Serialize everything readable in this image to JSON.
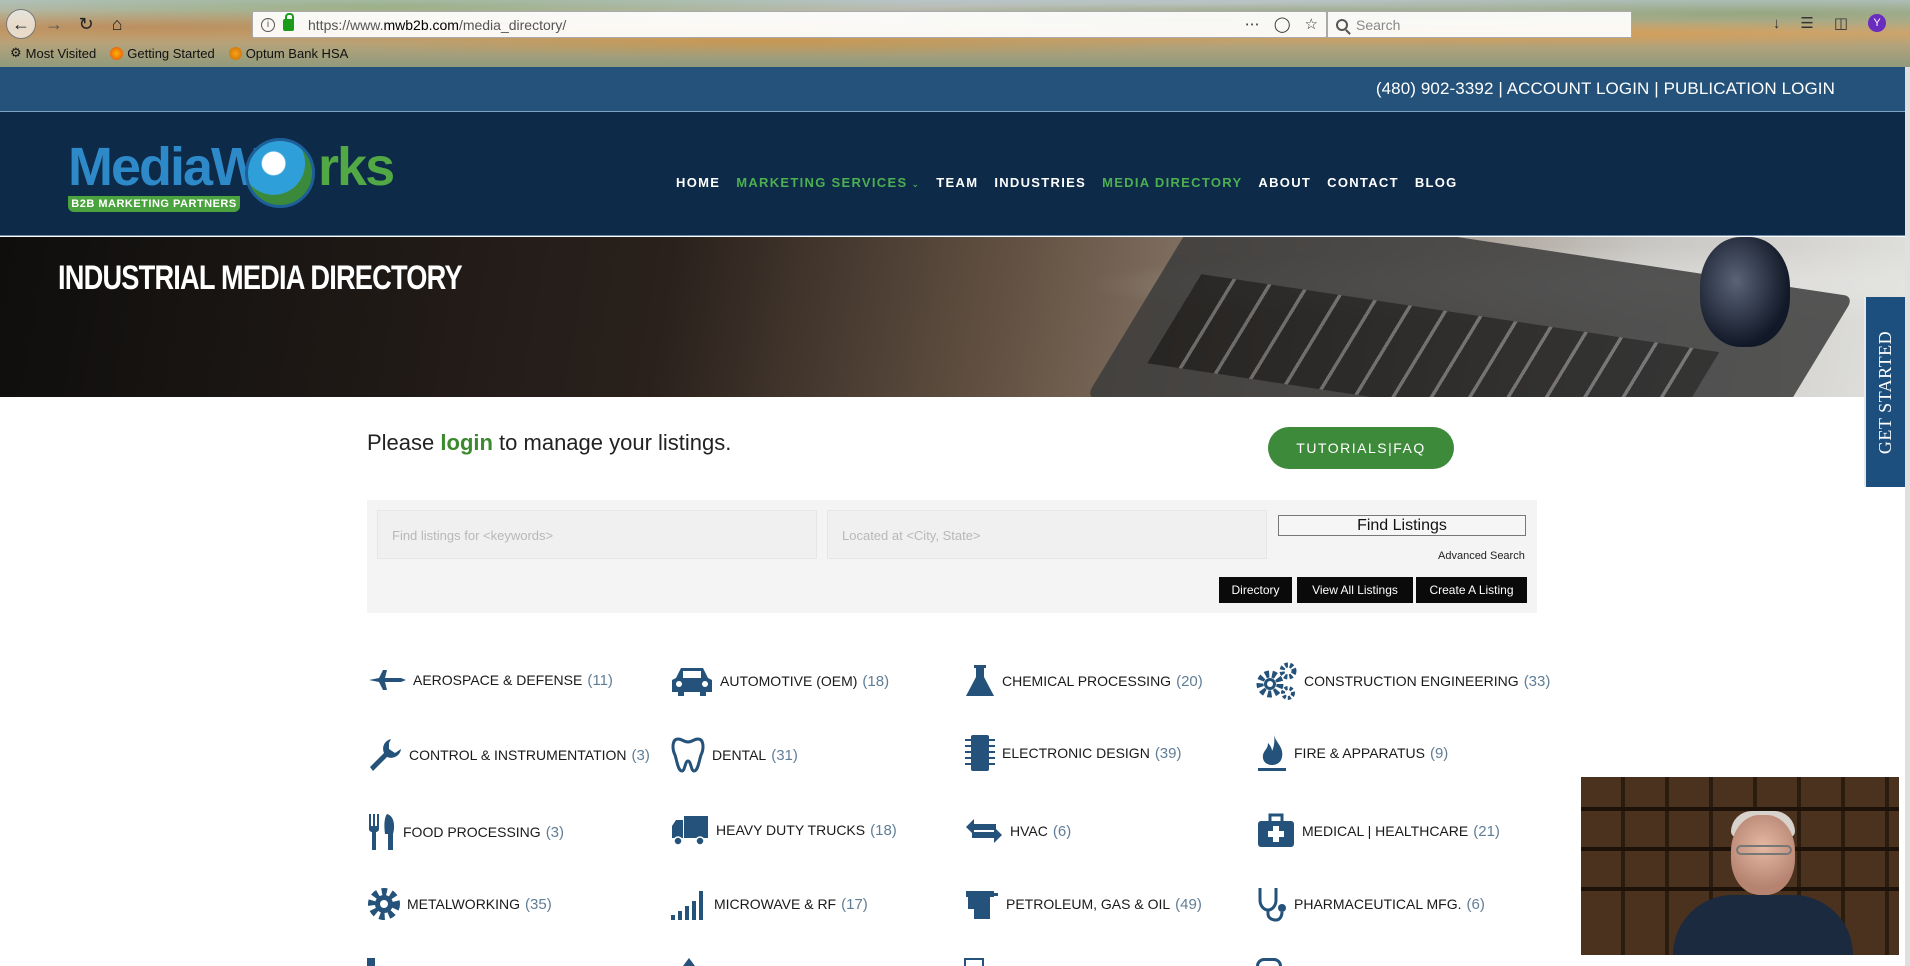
{
  "browser": {
    "url_prefix": "https://www.",
    "url_domain": "mwb2b.com",
    "url_path": "/media_directory/",
    "search_placeholder": "Search",
    "profile_initial": "Y",
    "bookmarks": [
      {
        "label": "Most Visited"
      },
      {
        "label": "Getting Started"
      },
      {
        "label": "Optum Bank HSA"
      }
    ]
  },
  "topbar": {
    "links_text": "(480) 902-3392 | ACCOUNT LOGIN | PUBLICATION LOGIN"
  },
  "logo": {
    "left_text": "MediaW",
    "right_text": "rks",
    "tagline": "B2B MARKETING PARTNERS"
  },
  "nav": {
    "items": [
      {
        "label": "HOME"
      },
      {
        "label": "MARKETING SERVICES"
      },
      {
        "label": "TEAM"
      },
      {
        "label": "INDUSTRIES"
      },
      {
        "label": "MEDIA DIRECTORY"
      },
      {
        "label": "ABOUT"
      },
      {
        "label": "CONTACT"
      },
      {
        "label": "BLOG"
      }
    ]
  },
  "hero": {
    "title": "INDUSTRIAL MEDIA DIRECTORY"
  },
  "side_tab": {
    "label": "GET STARTED"
  },
  "login_prompt": {
    "before": "Please ",
    "link": "login",
    "after": " to manage your listings."
  },
  "tutorials_label": "TUTORIALS|FAQ",
  "search": {
    "keywords_placeholder": "Find listings for <keywords>",
    "location_placeholder": "Located at <City, State>",
    "find_label": "Find Listings",
    "advanced_label": "Advanced Search",
    "directory_label": "Directory",
    "view_all_label": "View All Listings",
    "create_label": "Create A Listing"
  },
  "categories": [
    {
      "name": "AEROSPACE & DEFENSE",
      "count": "(11)",
      "icon": "jet-icon"
    },
    {
      "name": "AUTOMOTIVE (OEM)",
      "count": "(18)",
      "icon": "car-icon"
    },
    {
      "name": "CHEMICAL PROCESSING",
      "count": "(20)",
      "icon": "flask-icon"
    },
    {
      "name": "CONSTRUCTION ENGINEERING",
      "count": "(33)",
      "icon": "gears-icon"
    },
    {
      "name": "CONTROL & INSTRUMENTATION",
      "count": "(3)",
      "icon": "wrench-icon"
    },
    {
      "name": "DENTAL",
      "count": "(31)",
      "icon": "tooth-icon"
    },
    {
      "name": "ELECTRONIC DESIGN",
      "count": "(39)",
      "icon": "chip-icon"
    },
    {
      "name": "FIRE & APPARATUS",
      "count": "(9)",
      "icon": "flame-icon"
    },
    {
      "name": "FOOD PROCESSING",
      "count": "(3)",
      "icon": "utensils-icon"
    },
    {
      "name": "HEAVY DUTY TRUCKS",
      "count": "(18)",
      "icon": "truck-icon"
    },
    {
      "name": "HVAC",
      "count": "(6)",
      "icon": "exchange-icon"
    },
    {
      "name": "MEDICAL | HEALTHCARE",
      "count": "(21)",
      "icon": "medkit-icon"
    },
    {
      "name": "METALWORKING",
      "count": "(35)",
      "icon": "gear-icon"
    },
    {
      "name": "MICROWAVE & RF",
      "count": "(17)",
      "icon": "signal-bars-icon"
    },
    {
      "name": "PETROLEUM, GAS & OIL",
      "count": "(49)",
      "icon": "oil-pump-icon"
    },
    {
      "name": "PHARMACEUTICAL MFG.",
      "count": "(6)",
      "icon": "stethoscope-icon"
    }
  ],
  "colors": {
    "topbar": "#24527a",
    "navbar": "#0d2a49",
    "accent_green": "#3d8b3a",
    "icon_blue": "#24527a"
  }
}
